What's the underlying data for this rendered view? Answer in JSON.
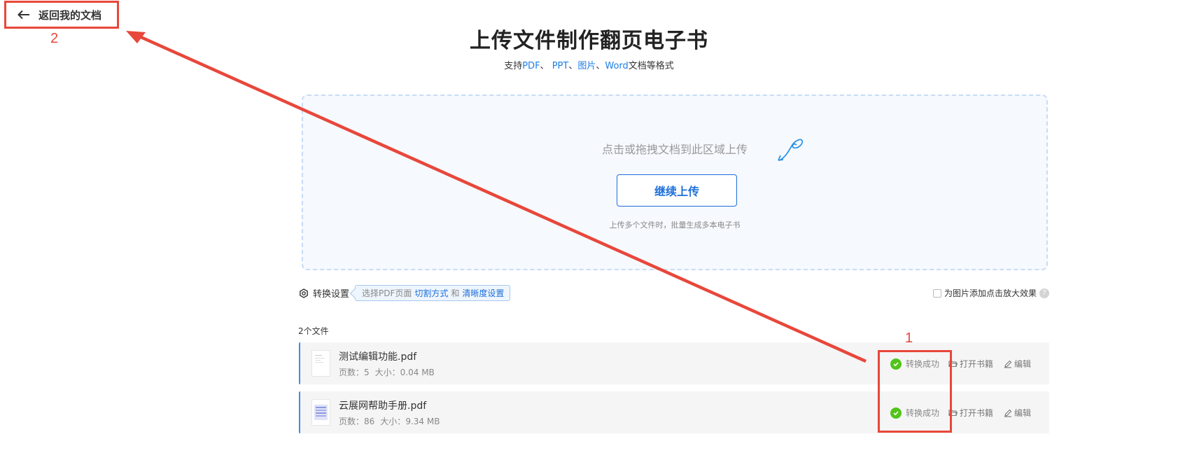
{
  "back": {
    "label": "返回我的文档"
  },
  "annotations": {
    "step1": "1",
    "step2": "2"
  },
  "header": {
    "title": "上传文件制作翻页电子书",
    "subtitle_prefix": "支持",
    "format_pdf": "PDF",
    "sep1": "、 ",
    "format_ppt": "PPT",
    "sep2": "、",
    "format_image": "图片",
    "sep3": "、",
    "format_word": "Word",
    "subtitle_suffix": "文档等格式"
  },
  "dropzone": {
    "hint": "点击或拖拽文档到此区域上传",
    "continue_label": "继续上传",
    "note": "上传多个文件时，批量生成多本电子书"
  },
  "settings": {
    "label": "转换设置",
    "tip_prefix": "选择PDF页面",
    "tip_link1": "切割方式",
    "tip_and": "和",
    "tip_link2": "清晰度设置",
    "zoom_label": "为图片添加点击放大效果",
    "zoom_checked": false
  },
  "files": {
    "count_label": "2个文件",
    "items": [
      {
        "name": "测试编辑功能.pdf",
        "pages_label": "页数：",
        "pages": "5",
        "size_label": "大小：",
        "size": "0.04 MB",
        "status": "转换成功",
        "open_label": "打开书籍",
        "edit_label": "编辑"
      },
      {
        "name": "云展网帮助手册.pdf",
        "pages_label": "页数：",
        "pages": "86",
        "size_label": "大小：",
        "size": "9.34 MB",
        "status": "转换成功",
        "open_label": "打开书籍",
        "edit_label": "编辑"
      }
    ]
  },
  "colors": {
    "accent": "#1e6fd9",
    "annotation": "#e8473b",
    "success": "#52c41a"
  }
}
